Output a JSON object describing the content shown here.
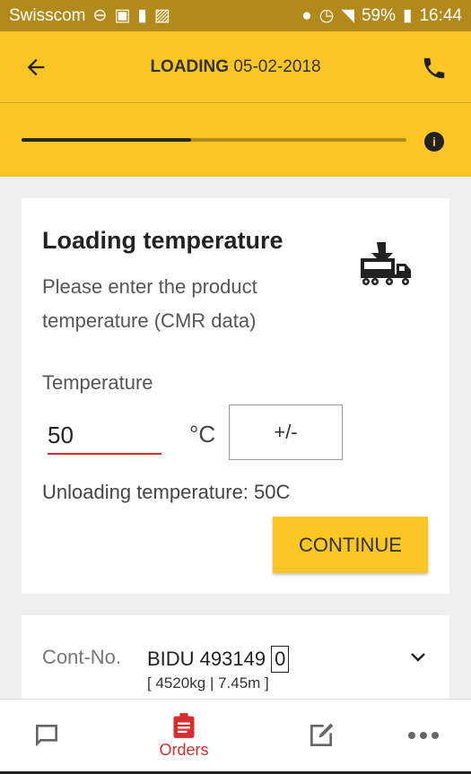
{
  "status_bar": {
    "carrier": "Swisscom",
    "battery": "59%",
    "time": "16:44"
  },
  "app_bar": {
    "title_bold": "LOADING",
    "title_date": "05-02-2018"
  },
  "progress": {
    "value_percent": 44
  },
  "card": {
    "title": "Loading temperature",
    "subtitle": "Please enter the product temperature (CMR data)",
    "temperature_label": "Temperature",
    "temperature_value": "50",
    "unit": "°C",
    "sign_button": "+/-",
    "unloading_text": "Unloading temperature: 50C",
    "continue_button": "CONTINUE"
  },
  "container": {
    "label": "Cont-No.",
    "number": "BIDU 493149",
    "count": "0",
    "details": "[ 4520kg | 7.45m ]"
  },
  "bottom_nav": {
    "orders": "Orders"
  },
  "colors": {
    "accent": "#fcc624",
    "status_bar": "#b28a1b",
    "active": "#d32f2f"
  }
}
